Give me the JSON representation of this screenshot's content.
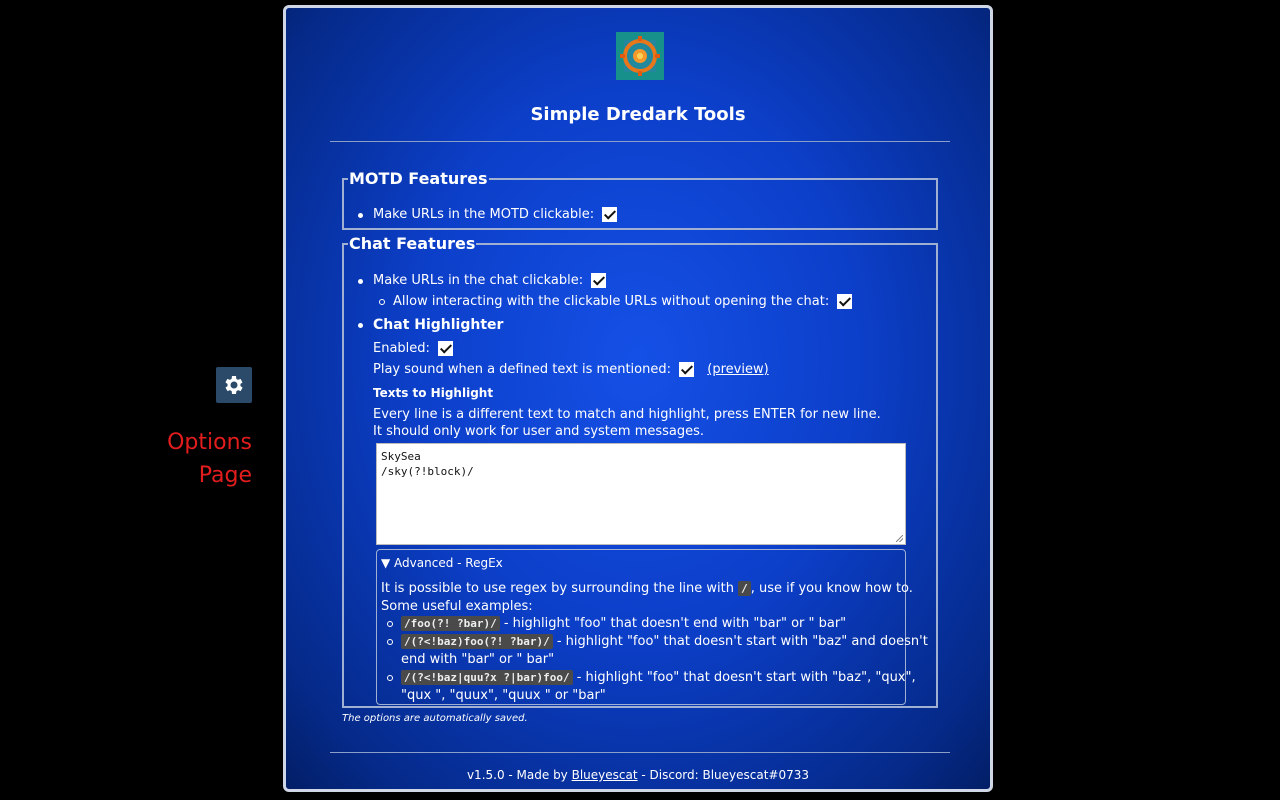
{
  "sidebar": {
    "gear_icon": "gear-icon",
    "options_label_line1": "Options",
    "options_label_line2": "Page",
    "label_color": "#e31d1d"
  },
  "header": {
    "title": "Simple Dredark Tools"
  },
  "motd": {
    "legend": "MOTD Features",
    "clickable_urls_label": "Make URLs in the MOTD clickable:",
    "clickable_urls_checked": true
  },
  "chat": {
    "legend": "Chat Features",
    "clickable_urls_label": "Make URLs in the chat clickable:",
    "clickable_urls_checked": true,
    "interact_label": "Allow interacting with the clickable URLs without opening the chat:",
    "interact_checked": true,
    "highlighter": {
      "heading": "Chat Highlighter",
      "enabled_label": "Enabled:",
      "enabled_checked": true,
      "sound_label": "Play sound when a defined text is mentioned:",
      "sound_checked": true,
      "preview_link": "(preview)",
      "texts_heading": "Texts to Highlight",
      "help_line1": "Every line is a different text to match and highlight, press ENTER for new line.",
      "help_line2": "It should only work for user and system messages.",
      "textarea_value": "SkySea\n/sky(?!block)/"
    },
    "advanced": {
      "summary": "▼ Advanced - RegEx",
      "intro_before": "It is possible to use regex by surrounding the line with",
      "intro_code": "/",
      "intro_after": ", use if you know how to.",
      "examples_heading": "Some useful examples:",
      "examples": [
        {
          "code": "/foo(?! ?bar)/",
          "desc": " - highlight \"foo\" that doesn't end with \"bar\" or \" bar\""
        },
        {
          "code": "/(?<!baz)foo(?! ?bar)/",
          "desc": " - highlight \"foo\" that doesn't start with \"baz\" and doesn't",
          "desc2": "end with \"bar\" or \" bar\""
        },
        {
          "code": "/(?<!baz|quu?x ?|bar)foo/",
          "desc": " - highlight \"foo\" that doesn't start with \"baz\", \"qux\",",
          "desc2": "\"qux \", \"quux\", \"quux \" or \"bar\""
        }
      ]
    }
  },
  "note": "The options are automatically saved.",
  "footer": {
    "prefix": "v1.5.0 - Made by ",
    "author_link": "Blueyescat",
    "suffix": " - Discord: Blueyescat#0733"
  }
}
